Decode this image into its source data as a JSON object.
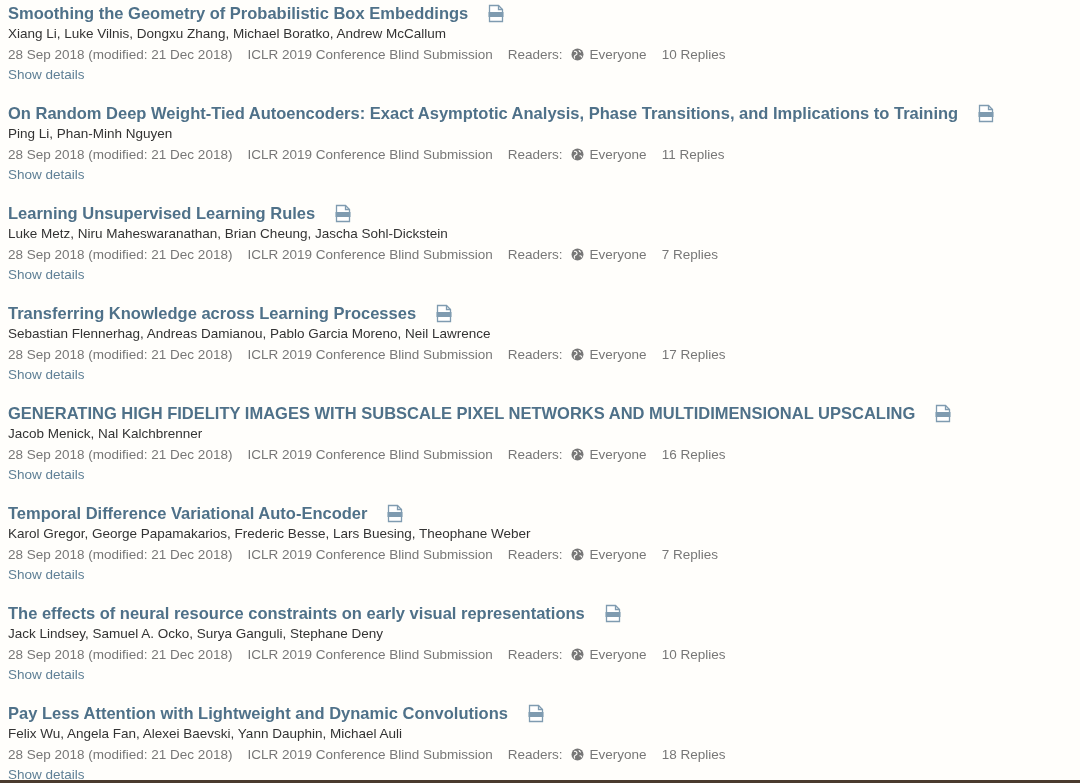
{
  "papers": [
    {
      "title": "Smoothing the Geometry of Probabilistic Box Embeddings",
      "authors": "Xiang Li, Luke Vilnis, Dongxu Zhang, Michael Boratko, Andrew McCallum",
      "date": "28 Sep 2018 (modified: 21 Dec 2018)",
      "venue": "ICLR 2019 Conference Blind Submission",
      "readers_label": "Readers:",
      "readers": "Everyone",
      "replies": "10 Replies",
      "details": "Show details"
    },
    {
      "title": "On Random Deep Weight-Tied Autoencoders: Exact Asymptotic Analysis, Phase Transitions, and Implications to Training",
      "authors": "Ping Li, Phan-Minh Nguyen",
      "date": "28 Sep 2018 (modified: 21 Dec 2018)",
      "venue": "ICLR 2019 Conference Blind Submission",
      "readers_label": "Readers:",
      "readers": "Everyone",
      "replies": "11 Replies",
      "details": "Show details"
    },
    {
      "title": "Learning Unsupervised Learning Rules",
      "authors": "Luke Metz, Niru Maheswaranathan, Brian Cheung, Jascha Sohl-Dickstein",
      "date": "28 Sep 2018 (modified: 21 Dec 2018)",
      "venue": "ICLR 2019 Conference Blind Submission",
      "readers_label": "Readers:",
      "readers": "Everyone",
      "replies": "7 Replies",
      "details": "Show details"
    },
    {
      "title": "Transferring Knowledge across Learning Processes",
      "authors": "Sebastian Flennerhag, Andreas Damianou, Pablo Garcia Moreno, Neil Lawrence",
      "date": "28 Sep 2018 (modified: 21 Dec 2018)",
      "venue": "ICLR 2019 Conference Blind Submission",
      "readers_label": "Readers:",
      "readers": "Everyone",
      "replies": "17 Replies",
      "details": "Show details"
    },
    {
      "title": "GENERATING HIGH FIDELITY IMAGES WITH SUBSCALE PIXEL NETWORKS AND MULTIDIMENSIONAL UPSCALING",
      "authors": "Jacob Menick, Nal Kalchbrenner",
      "date": "28 Sep 2018 (modified: 21 Dec 2018)",
      "venue": "ICLR 2019 Conference Blind Submission",
      "readers_label": "Readers:",
      "readers": "Everyone",
      "replies": "16 Replies",
      "details": "Show details"
    },
    {
      "title": "Temporal Difference Variational Auto-Encoder",
      "authors": "Karol Gregor, George Papamakarios, Frederic Besse, Lars Buesing, Theophane Weber",
      "date": "28 Sep 2018 (modified: 21 Dec 2018)",
      "venue": "ICLR 2019 Conference Blind Submission",
      "readers_label": "Readers:",
      "readers": "Everyone",
      "replies": "7 Replies",
      "details": "Show details"
    },
    {
      "title": "The effects of neural resource constraints on early visual representations",
      "authors": "Jack Lindsey, Samuel A. Ocko, Surya Ganguli, Stephane Deny",
      "date": "28 Sep 2018 (modified: 21 Dec 2018)",
      "venue": "ICLR 2019 Conference Blind Submission",
      "readers_label": "Readers:",
      "readers": "Everyone",
      "replies": "10 Replies",
      "details": "Show details"
    },
    {
      "title": "Pay Less Attention with Lightweight and Dynamic Convolutions",
      "authors": "Felix Wu, Angela Fan, Alexei Baevski, Yann Dauphin, Michael Auli",
      "date": "28 Sep 2018 (modified: 21 Dec 2018)",
      "venue": "ICLR 2019 Conference Blind Submission",
      "readers_label": "Readers:",
      "readers": "Everyone",
      "replies": "18 Replies",
      "details": "Show details"
    }
  ]
}
